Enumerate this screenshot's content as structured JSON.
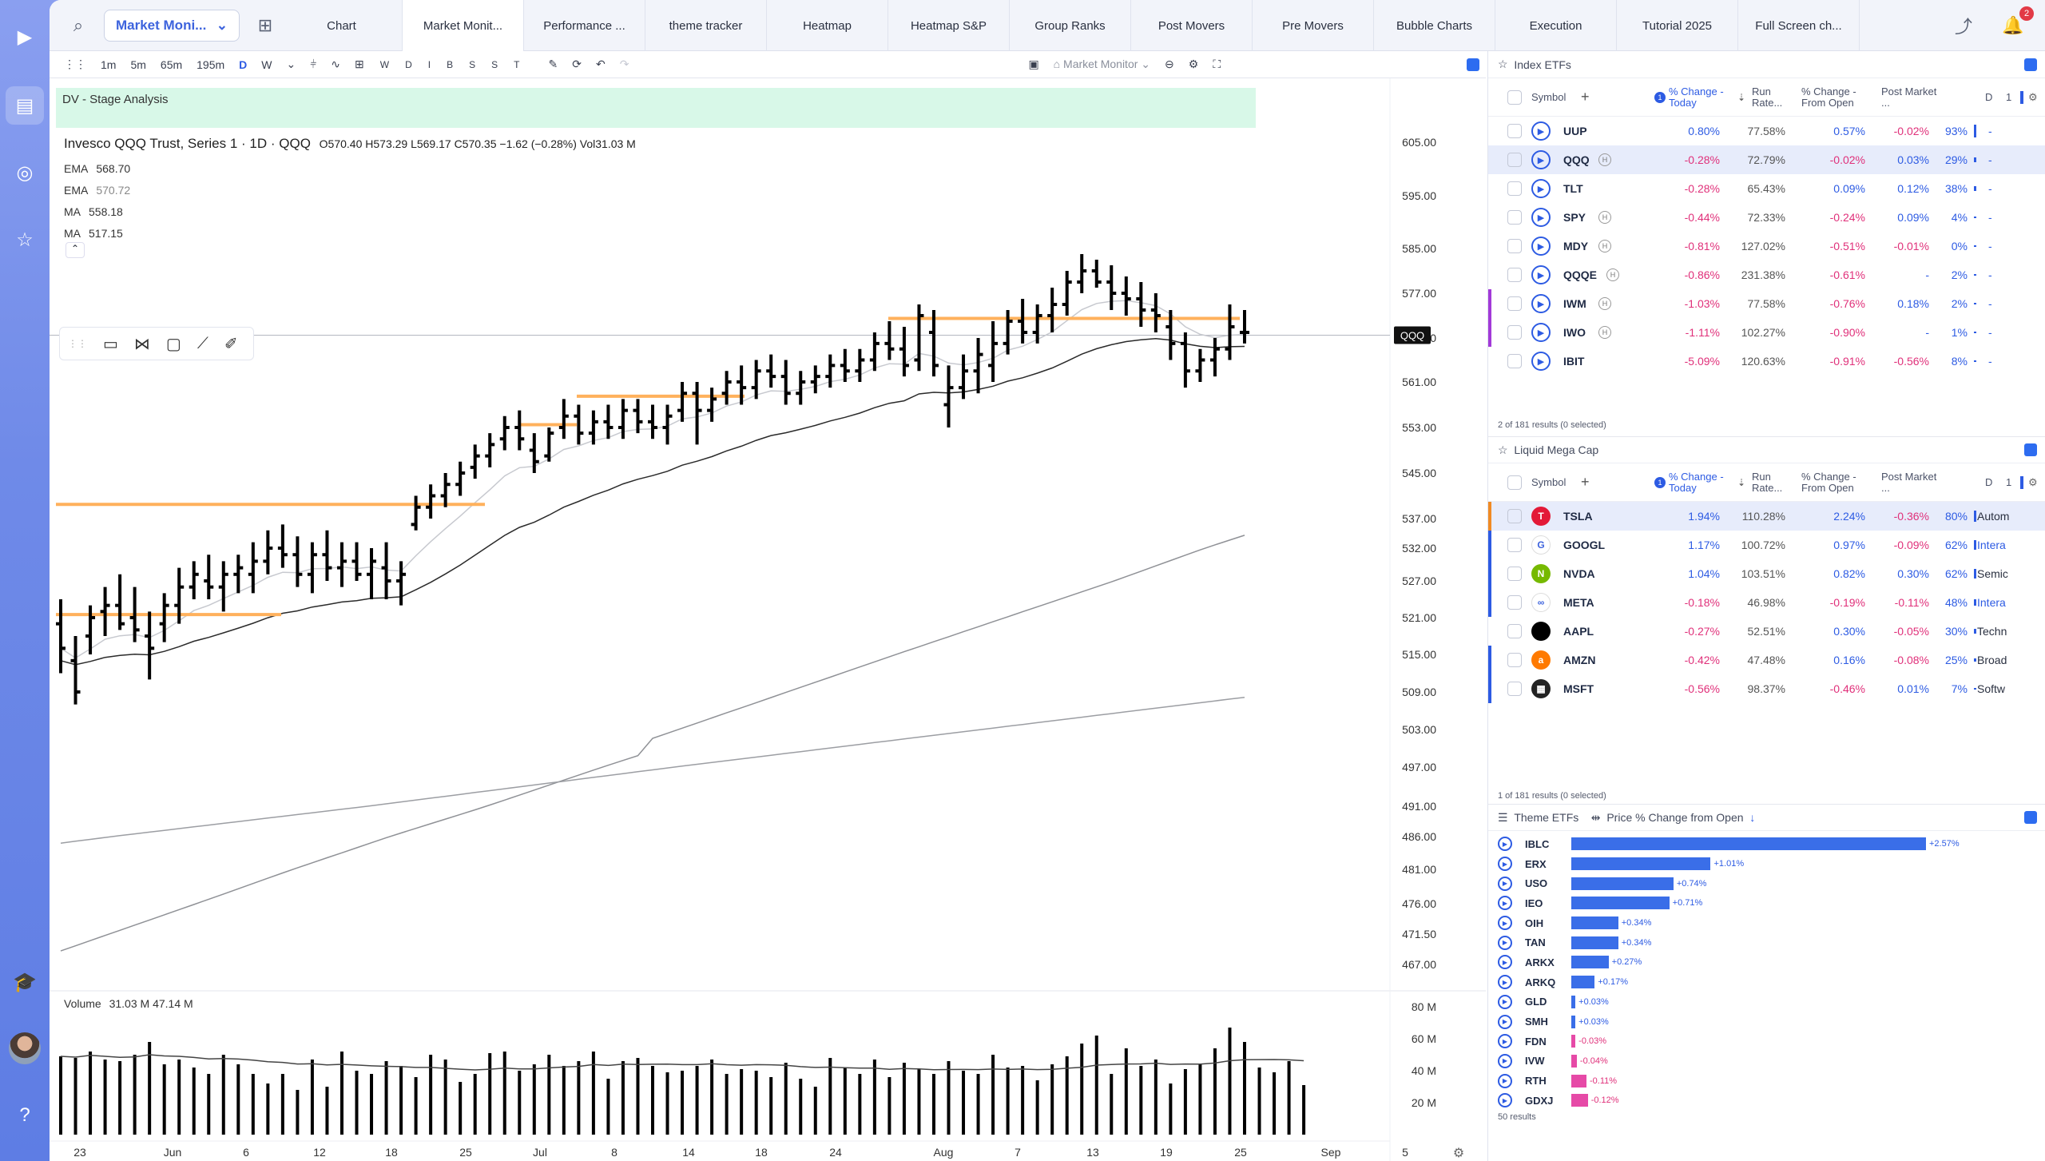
{
  "app": {
    "selector_label": "Market Moni...",
    "tabs": [
      "Chart",
      "Market Monit...",
      "Performance ...",
      "theme tracker",
      "Heatmap",
      "Heatmap S&P",
      "Group Ranks",
      "Post Movers",
      "Pre Movers",
      "Bubble Charts",
      "Execution",
      "Tutorial 2025",
      "Full Screen ch..."
    ],
    "active_tab": 1,
    "notification_count": "2"
  },
  "toolbar": {
    "intervals": [
      "1m",
      "5m",
      "65m",
      "195m",
      "D",
      "W"
    ],
    "active_interval": "D",
    "letters": [
      "W",
      "D",
      "I",
      "B",
      "S",
      "S",
      "T"
    ],
    "layout_label": "Market Monitor"
  },
  "chart": {
    "banner": "DV - Stage Analysis",
    "title": "Invesco QQQ Trust, Series 1 · 1D · QQQ",
    "ohlc": "O570.40  H573.29  L569.17  C570.35  −1.62 (−0.28%)  Vol31.03 M",
    "indicators": [
      {
        "name": "EMA",
        "value": "568.70"
      },
      {
        "name": "EMA",
        "value": "570.72"
      },
      {
        "name": "MA",
        "value": "558.18"
      },
      {
        "name": "MA",
        "value": "517.15"
      }
    ],
    "last_label": "QQQ",
    "price_ticks": [
      "605.00",
      "595.00",
      "585.00",
      "577.00",
      "569.00",
      "561.00",
      "553.00",
      "545.00",
      "537.00",
      "532.00",
      "527.00",
      "521.00",
      "515.00",
      "509.00",
      "503.00",
      "497.00",
      "491.00",
      "486.00",
      "481.00",
      "476.00",
      "471.50",
      "467.00"
    ],
    "volume_label": "Volume",
    "volume_values": "31.03 M  47.14 M",
    "volume_ticks": [
      "80 M",
      "60 M",
      "40 M",
      "20 M"
    ],
    "date_ticks": [
      "23",
      "Jun",
      "6",
      "12",
      "18",
      "25",
      "Jul",
      "8",
      "14",
      "18",
      "24",
      "Aug",
      "7",
      "13",
      "19",
      "25",
      "Sep",
      "5"
    ]
  },
  "chart_data": {
    "type": "ohlc",
    "symbol": "QQQ",
    "y_range": [
      467,
      605
    ],
    "bars": [
      [
        520,
        524,
        512,
        516
      ],
      [
        514,
        518,
        507,
        509
      ],
      [
        518,
        523,
        515,
        521
      ],
      [
        522,
        526,
        518,
        523
      ],
      [
        523,
        528,
        519,
        520
      ],
      [
        521,
        526,
        517,
        519
      ],
      [
        518,
        522,
        511,
        516
      ],
      [
        520,
        525,
        517,
        523
      ],
      [
        523,
        529,
        520,
        526
      ],
      [
        526,
        530,
        524,
        528
      ],
      [
        527,
        531,
        524,
        526
      ],
      [
        526,
        530,
        522,
        528
      ],
      [
        528,
        531,
        525,
        529
      ],
      [
        528,
        533,
        525,
        530
      ],
      [
        530,
        535,
        528,
        532
      ],
      [
        532,
        536,
        529,
        531
      ],
      [
        531,
        534,
        526,
        528
      ],
      [
        528,
        533,
        525,
        531
      ],
      [
        531,
        535,
        527,
        529
      ],
      [
        529,
        533,
        526,
        530
      ],
      [
        530,
        533,
        527,
        528
      ],
      [
        528,
        532,
        524,
        530
      ],
      [
        529,
        533,
        524,
        527
      ],
      [
        527,
        530,
        523,
        528
      ],
      [
        536,
        541,
        535,
        539
      ],
      [
        539,
        543,
        537,
        541
      ],
      [
        541,
        545,
        539,
        543
      ],
      [
        543,
        547,
        541,
        545
      ],
      [
        546,
        550,
        544,
        548
      ],
      [
        548,
        552,
        546,
        550
      ],
      [
        551,
        555,
        549,
        553
      ],
      [
        553,
        556,
        549,
        551
      ],
      [
        549,
        552,
        545,
        547
      ],
      [
        548,
        553,
        547,
        552
      ],
      [
        553,
        558,
        551,
        555
      ],
      [
        555,
        557,
        550,
        552
      ],
      [
        552,
        556,
        550,
        554
      ],
      [
        554,
        557,
        551,
        553
      ],
      [
        553,
        558,
        551,
        556
      ],
      [
        556,
        558,
        552,
        554
      ],
      [
        554,
        557,
        551,
        553
      ],
      [
        553,
        557,
        550,
        555
      ],
      [
        556,
        561,
        554,
        559
      ],
      [
        559,
        561,
        550,
        556
      ],
      [
        556,
        560,
        554,
        558
      ],
      [
        559,
        563,
        557,
        561
      ],
      [
        561,
        564,
        557,
        560
      ],
      [
        560,
        565,
        558,
        563
      ],
      [
        563,
        566,
        560,
        562
      ],
      [
        562,
        565,
        557,
        559
      ],
      [
        559,
        563,
        557,
        561
      ],
      [
        561,
        564,
        559,
        562
      ],
      [
        562,
        566,
        560,
        564
      ],
      [
        564,
        567,
        561,
        563
      ],
      [
        563,
        567,
        561,
        565
      ],
      [
        565,
        570,
        563,
        568
      ],
      [
        568,
        572,
        565,
        567
      ],
      [
        567,
        571,
        562,
        564
      ],
      [
        565,
        575,
        563,
        573
      ],
      [
        570,
        574,
        562,
        564
      ],
      [
        557,
        564,
        553,
        560
      ],
      [
        560,
        566,
        558,
        563
      ],
      [
        563,
        569,
        559,
        566
      ],
      [
        564,
        572,
        561,
        568
      ],
      [
        568,
        574,
        566,
        572
      ],
      [
        572,
        576,
        568,
        570
      ],
      [
        570,
        575,
        568,
        573
      ],
      [
        573,
        578,
        570,
        575
      ],
      [
        575,
        581,
        573,
        579
      ],
      [
        579,
        584,
        577,
        581
      ],
      [
        581,
        583,
        578,
        579
      ],
      [
        579,
        582,
        574,
        577
      ],
      [
        577,
        580,
        573,
        576
      ],
      [
        576,
        579,
        571,
        574
      ],
      [
        574,
        577,
        570,
        573
      ],
      [
        571,
        574,
        565,
        568
      ],
      [
        568,
        570,
        560,
        563
      ],
      [
        563,
        567,
        561,
        565
      ],
      [
        565,
        569,
        562,
        567
      ],
      [
        567,
        575,
        565,
        571
      ],
      [
        570,
        574,
        568,
        570
      ]
    ],
    "volume_m": [
      49,
      48,
      52,
      47,
      46,
      50,
      58,
      44,
      47,
      42,
      38,
      50,
      44,
      38,
      32,
      38,
      28,
      47,
      30,
      52,
      40,
      38,
      46,
      43,
      36,
      50,
      47,
      33,
      38,
      51,
      52,
      40,
      44,
      50,
      43,
      46,
      52,
      35,
      46,
      48,
      43,
      39,
      40,
      43,
      47,
      38,
      41,
      40,
      36,
      45,
      35,
      30,
      48,
      42,
      38,
      47,
      36,
      45,
      41,
      38,
      46,
      40,
      38,
      50,
      42,
      43,
      34,
      44,
      49,
      57,
      62,
      38,
      54,
      43,
      47,
      32,
      41,
      44,
      54,
      67,
      58,
      42,
      39,
      46,
      31
    ],
    "orange_levels": [
      {
        "price": 521.5
      },
      {
        "price": 539.5
      },
      {
        "price": 553.5
      },
      {
        "price": 558.5
      },
      {
        "price": 572.5
      }
    ],
    "last_price": 569.5
  },
  "index_etfs": {
    "title": "Index ETFs",
    "columns": [
      "Symbol",
      "% Change - Today",
      "Run Rate...",
      "% Change - From Open",
      "Post Market ...",
      "D",
      "1"
    ],
    "rows": [
      {
        "sym": "UUP",
        "chg": "0.80%",
        "run": "77.58%",
        "open": "0.57%",
        "post": "-0.02%",
        "d": "93%"
      },
      {
        "sym": "QQQ",
        "chg": "-0.28%",
        "run": "72.79%",
        "open": "-0.02%",
        "post": "0.03%",
        "d": "29%"
      },
      {
        "sym": "TLT",
        "chg": "-0.28%",
        "run": "65.43%",
        "open": "0.09%",
        "post": "0.12%",
        "d": "38%"
      },
      {
        "sym": "SPY",
        "chg": "-0.44%",
        "run": "72.33%",
        "open": "-0.24%",
        "post": "0.09%",
        "d": "4%"
      },
      {
        "sym": "MDY",
        "chg": "-0.81%",
        "run": "127.02%",
        "open": "-0.51%",
        "post": "-0.01%",
        "d": "0%"
      },
      {
        "sym": "QQQE",
        "chg": "-0.86%",
        "run": "231.38%",
        "open": "-0.61%",
        "post": "-",
        "d": "2%"
      },
      {
        "sym": "IWM",
        "chg": "-1.03%",
        "run": "77.58%",
        "open": "-0.76%",
        "post": "0.18%",
        "d": "2%"
      },
      {
        "sym": "IWO",
        "chg": "-1.11%",
        "run": "102.27%",
        "open": "-0.90%",
        "post": "-",
        "d": "1%"
      },
      {
        "sym": "IBIT",
        "chg": "-5.09%",
        "run": "120.63%",
        "open": "-0.91%",
        "post": "-0.56%",
        "d": "8%"
      }
    ],
    "footer": "2 of 181 results (0 selected)"
  },
  "mega_cap": {
    "title": "Liquid Mega Cap",
    "rows": [
      {
        "sym": "TSLA",
        "chg": "1.94%",
        "run": "110.28%",
        "open": "2.24%",
        "post": "-0.36%",
        "d": "80%",
        "ind": "Autom",
        "color": "#e31937",
        "glyph": "T"
      },
      {
        "sym": "GOOGL",
        "chg": "1.17%",
        "run": "100.72%",
        "open": "0.97%",
        "post": "-0.09%",
        "d": "62%",
        "ind": "Intera",
        "color": "#ffffff",
        "glyph": "G"
      },
      {
        "sym": "NVDA",
        "chg": "1.04%",
        "run": "103.51%",
        "open": "0.82%",
        "post": "0.30%",
        "d": "62%",
        "ind": "Semic",
        "color": "#76b900",
        "glyph": "N"
      },
      {
        "sym": "META",
        "chg": "-0.18%",
        "run": "46.98%",
        "open": "-0.19%",
        "post": "-0.11%",
        "d": "48%",
        "ind": "Intera",
        "color": "#ffffff",
        "glyph": "∞"
      },
      {
        "sym": "AAPL",
        "chg": "-0.27%",
        "run": "52.51%",
        "open": "0.30%",
        "post": "-0.05%",
        "d": "30%",
        "ind": "Techn",
        "color": "#000000",
        "glyph": ""
      },
      {
        "sym": "AMZN",
        "chg": "-0.42%",
        "run": "47.48%",
        "open": "0.16%",
        "post": "-0.08%",
        "d": "25%",
        "ind": "Broad",
        "color": "#ff7a00",
        "glyph": "a"
      },
      {
        "sym": "MSFT",
        "chg": "-0.56%",
        "run": "98.37%",
        "open": "-0.46%",
        "post": "0.01%",
        "d": "7%",
        "ind": "Softw",
        "color": "#222222",
        "glyph": "▦"
      }
    ],
    "footer": "1 of 181 results (0 selected)"
  },
  "theme_etfs": {
    "title": "Theme ETFs",
    "metric": "Price % Change from Open",
    "rows": [
      {
        "sym": "IBLC",
        "val": 2.57,
        "label": "+2.57%"
      },
      {
        "sym": "ERX",
        "val": 1.01,
        "label": "+1.01%"
      },
      {
        "sym": "USO",
        "val": 0.74,
        "label": "+0.74%"
      },
      {
        "sym": "IEO",
        "val": 0.71,
        "label": "+0.71%"
      },
      {
        "sym": "OIH",
        "val": 0.34,
        "label": "+0.34%"
      },
      {
        "sym": "TAN",
        "val": 0.34,
        "label": "+0.34%"
      },
      {
        "sym": "ARKX",
        "val": 0.27,
        "label": "+0.27%"
      },
      {
        "sym": "ARKQ",
        "val": 0.17,
        "label": "+0.17%"
      },
      {
        "sym": "GLD",
        "val": 0.03,
        "label": "+0.03%"
      },
      {
        "sym": "SMH",
        "val": 0.03,
        "label": "+0.03%"
      },
      {
        "sym": "FDN",
        "val": -0.03,
        "label": "-0.03%"
      },
      {
        "sym": "IVW",
        "val": -0.04,
        "label": "-0.04%"
      },
      {
        "sym": "RTH",
        "val": -0.11,
        "label": "-0.11%"
      },
      {
        "sym": "GDXJ",
        "val": -0.12,
        "label": "-0.12%"
      }
    ],
    "footer": "50 results"
  }
}
